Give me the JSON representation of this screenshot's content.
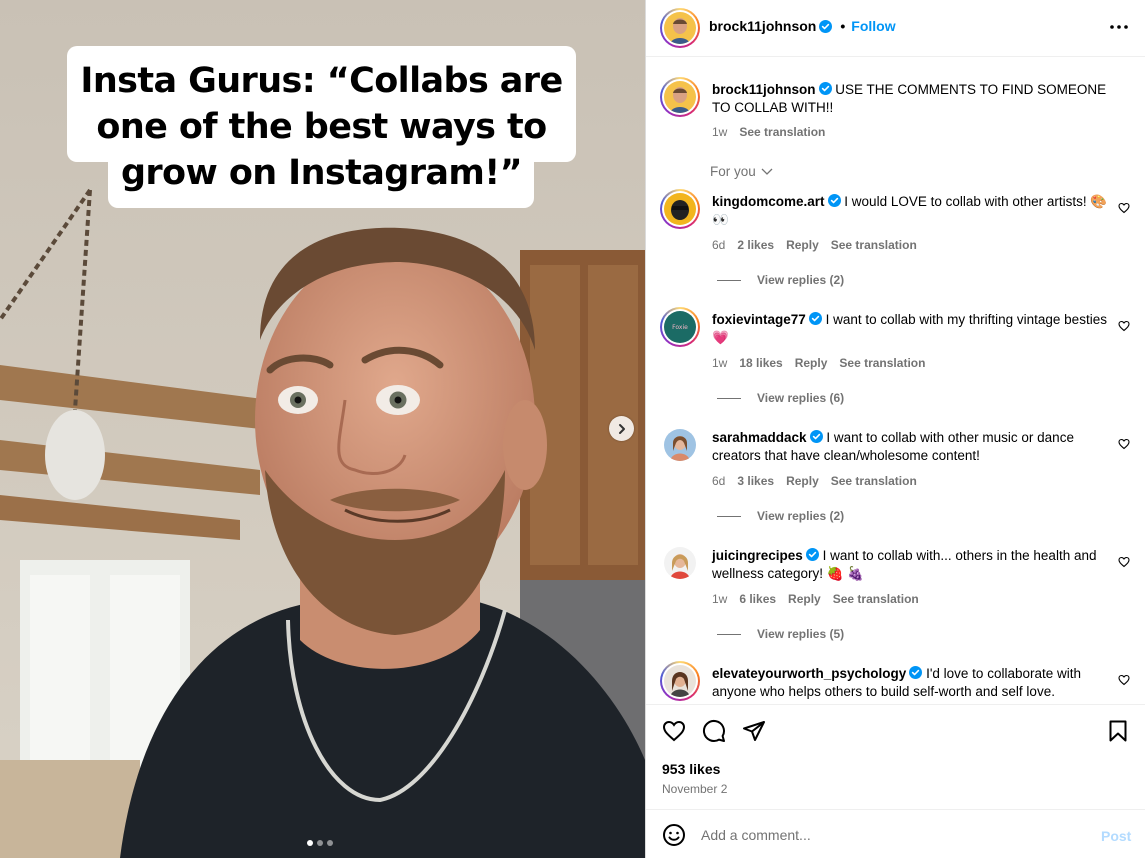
{
  "media": {
    "caption_overlay": "Insta Gurus: “Collabs are one of the best ways to grow on Instagram!”",
    "carousel_dots": 3,
    "active_dot": 1
  },
  "header": {
    "username": "brock11johnson",
    "separator": "•",
    "follow_label": "Follow"
  },
  "post_caption": {
    "username": "brock11johnson",
    "text": "USE THE COMMENTS TO FIND SOMEONE TO COLLAB WITH!!",
    "time": "1w",
    "see_translation": "See translation"
  },
  "sort_label": "For you",
  "comments": [
    {
      "username": "kingdomcome.art",
      "text": "I would LOVE to collab with other artists! 🎨 👀",
      "time": "6d",
      "likes": "2 likes",
      "reply": "Reply",
      "see_translation": "See translation",
      "view_replies": "View replies (2)"
    },
    {
      "username": "foxievintage77",
      "text": "I want to collab with my thrifting vintage besties 💗",
      "time": "1w",
      "likes": "18 likes",
      "reply": "Reply",
      "see_translation": "See translation",
      "view_replies": "View replies (6)"
    },
    {
      "username": "sarahmaddack",
      "text": "I want to collab with other music or dance creators that have clean/wholesome content!",
      "time": "6d",
      "likes": "3 likes",
      "reply": "Reply",
      "see_translation": "See translation",
      "view_replies": "View replies (2)"
    },
    {
      "username": "juicingrecipes",
      "text": "I want to collab with... others in the health and wellness category! 🍓 🍇",
      "time": "1w",
      "likes": "6 likes",
      "reply": "Reply",
      "see_translation": "See translation",
      "view_replies": "View replies (5)"
    },
    {
      "username": "elevateyourworth_psychology",
      "text": "I'd love to collaborate with anyone who helps others to build self-worth and self love."
    }
  ],
  "footer": {
    "likes": "953 likes",
    "date": "November 2",
    "comment_placeholder": "Add a comment...",
    "post_label": "Post"
  },
  "icons": {
    "verified": "verified-badge-icon",
    "like": "heart-icon",
    "comment": "comment-bubble-icon",
    "share": "paper-plane-icon",
    "save": "bookmark-icon",
    "emoji": "smiley-icon",
    "more": "more-dots-icon",
    "next": "chevron-right-icon"
  },
  "colors": {
    "accent": "#0095f6",
    "verified": "#0095f6",
    "muted": "#737373",
    "post_disabled": "#b3dbff"
  }
}
